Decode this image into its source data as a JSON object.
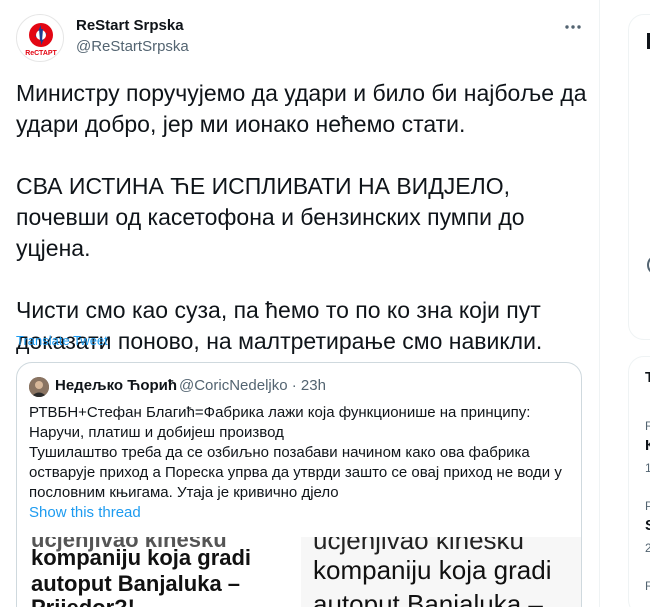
{
  "author": {
    "display_name": "ReStart Srpska",
    "handle": "@ReStartSrpska",
    "avatar_label": "ReСТАРТ"
  },
  "tweet": {
    "paragraphs": [
      "Министру поручујемо да udari и било би најбоље да удари добро, јер ми ионако нећемо стати.",
      "СВА ИСТИНА ЋЕ ИСПЛИВАТИ НА ВИДЈЕЛО, почевши од касетофона и бензинских пумпи до уцјена.",
      "Чисти смо као суза, па ћемо то по ко зна који пут доказати поново, на малтретирање смо навикли."
    ],
    "lines": [
      "Министру поручујемо да удари и било би најбоље да",
      "удари добро, јер ми ионако нећемо стати.",
      "СВА ИСТИНА ЋЕ ИСПЛИВАТИ НА ВИДЈЕЛО,",
      "почевши од касетофона и бензинских пумпи до",
      "уцјена.",
      "Чисти смо као суза, па ћемо то по ко зна који пут",
      "доказати поново, на малтретирање смо навикли."
    ],
    "translate_label": "Translate Tweet"
  },
  "quote": {
    "display_name": "Недељко Ћорић",
    "handle_time": "@CoricNedeljko · 23h",
    "lines": [
      "РТВБН+Стефан Благић=Фабрика лажи која функционише на принципу:",
      "Наручи, платиш и добијеш производ",
      "Тушилаштво треба да се озбиљно позабави начином како ова фабрика",
      "остварује приход а Пореска упрва да утврди зашто се овај приход не води у",
      "пословним књигама. Утаја је кривично дјело"
    ],
    "show_thread_label": "Show this thread",
    "image_left_lines": [
      "ucjenjivao kinesku",
      "kompaniju koja gradi",
      "autoput Banjaluka –",
      "Prijedor?!"
    ],
    "image_right_lines": [
      "ucjenjivao kinesku",
      "kompaniju koja gradi",
      "autoput Banjaluka –"
    ]
  },
  "sidebar_fragments": {
    "panel1_top": "",
    "p2_r1": "T",
    "p2_r2": "R",
    "p2_r3": "К",
    "p2_r4": "1",
    "p2_r5": "P",
    "p2_r6": "S",
    "p2_r7": "2",
    "p2_r8": "R"
  },
  "icons": {
    "more": "more-horizontal-icon"
  },
  "colors": {
    "link": "#1d9bf0",
    "secondary_text": "#536471",
    "border": "#cfd9de",
    "brand_red": "#e30613",
    "brand_blue": "#1f3d8f"
  }
}
